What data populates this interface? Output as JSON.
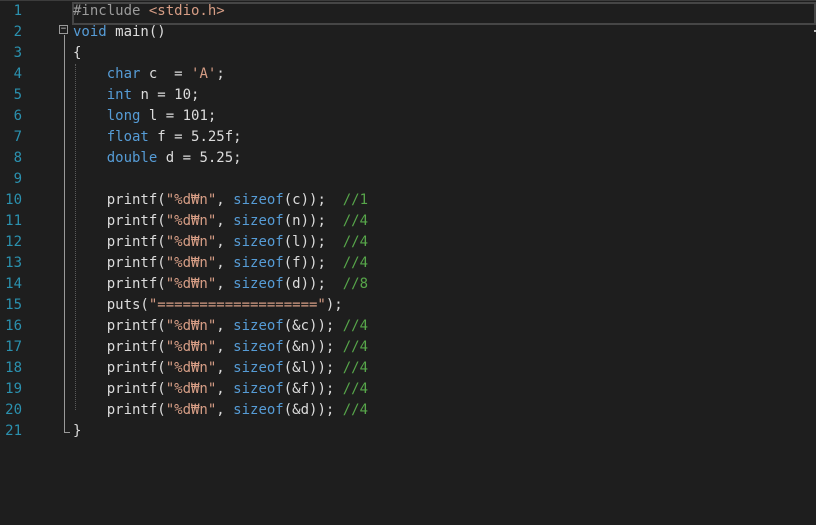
{
  "editor": {
    "line_numbers": [
      "1",
      "2",
      "3",
      "4",
      "5",
      "6",
      "7",
      "8",
      "9",
      "10",
      "11",
      "12",
      "13",
      "14",
      "15",
      "16",
      "17",
      "18",
      "19",
      "20",
      "21"
    ],
    "collapse_symbol": "−",
    "lines": [
      [
        {
          "t": "#include ",
          "c": "pp"
        },
        {
          "t": "<stdio.h>",
          "c": "str"
        }
      ],
      [
        {
          "t": "void",
          "c": "kw"
        },
        {
          "t": " main()",
          "c": "plain"
        }
      ],
      [
        {
          "t": "{",
          "c": "plain"
        }
      ],
      [
        {
          "t": "    ",
          "c": "plain"
        },
        {
          "t": "char",
          "c": "kw"
        },
        {
          "t": " c  = ",
          "c": "plain"
        },
        {
          "t": "'A'",
          "c": "str"
        },
        {
          "t": ";",
          "c": "plain"
        }
      ],
      [
        {
          "t": "    ",
          "c": "plain"
        },
        {
          "t": "int",
          "c": "kw"
        },
        {
          "t": " n = 10;",
          "c": "plain"
        }
      ],
      [
        {
          "t": "    ",
          "c": "plain"
        },
        {
          "t": "long",
          "c": "kw"
        },
        {
          "t": " l = 101;",
          "c": "plain"
        }
      ],
      [
        {
          "t": "    ",
          "c": "plain"
        },
        {
          "t": "float",
          "c": "kw"
        },
        {
          "t": " f = 5.25f;",
          "c": "plain"
        }
      ],
      [
        {
          "t": "    ",
          "c": "plain"
        },
        {
          "t": "double",
          "c": "kw"
        },
        {
          "t": " d = 5.25;",
          "c": "plain"
        }
      ],
      [],
      [
        {
          "t": "    printf(",
          "c": "plain"
        },
        {
          "t": "\"%d₩n\"",
          "c": "str"
        },
        {
          "t": ", ",
          "c": "plain"
        },
        {
          "t": "sizeof",
          "c": "kw"
        },
        {
          "t": "(c));  ",
          "c": "plain"
        },
        {
          "t": "//1",
          "c": "cmt"
        }
      ],
      [
        {
          "t": "    printf(",
          "c": "plain"
        },
        {
          "t": "\"%d₩n\"",
          "c": "str"
        },
        {
          "t": ", ",
          "c": "plain"
        },
        {
          "t": "sizeof",
          "c": "kw"
        },
        {
          "t": "(n));  ",
          "c": "plain"
        },
        {
          "t": "//4",
          "c": "cmt"
        }
      ],
      [
        {
          "t": "    printf(",
          "c": "plain"
        },
        {
          "t": "\"%d₩n\"",
          "c": "str"
        },
        {
          "t": ", ",
          "c": "plain"
        },
        {
          "t": "sizeof",
          "c": "kw"
        },
        {
          "t": "(l));  ",
          "c": "plain"
        },
        {
          "t": "//4",
          "c": "cmt"
        }
      ],
      [
        {
          "t": "    printf(",
          "c": "plain"
        },
        {
          "t": "\"%d₩n\"",
          "c": "str"
        },
        {
          "t": ", ",
          "c": "plain"
        },
        {
          "t": "sizeof",
          "c": "kw"
        },
        {
          "t": "(f));  ",
          "c": "plain"
        },
        {
          "t": "//4",
          "c": "cmt"
        }
      ],
      [
        {
          "t": "    printf(",
          "c": "plain"
        },
        {
          "t": "\"%d₩n\"",
          "c": "str"
        },
        {
          "t": ", ",
          "c": "plain"
        },
        {
          "t": "sizeof",
          "c": "kw"
        },
        {
          "t": "(d));  ",
          "c": "plain"
        },
        {
          "t": "//8",
          "c": "cmt"
        }
      ],
      [
        {
          "t": "    puts(",
          "c": "plain"
        },
        {
          "t": "\"===================\"",
          "c": "str"
        },
        {
          "t": ");",
          "c": "plain"
        }
      ],
      [
        {
          "t": "    printf(",
          "c": "plain"
        },
        {
          "t": "\"%d₩n\"",
          "c": "str"
        },
        {
          "t": ", ",
          "c": "plain"
        },
        {
          "t": "sizeof",
          "c": "kw"
        },
        {
          "t": "(&c)); ",
          "c": "plain"
        },
        {
          "t": "//4",
          "c": "cmt"
        }
      ],
      [
        {
          "t": "    printf(",
          "c": "plain"
        },
        {
          "t": "\"%d₩n\"",
          "c": "str"
        },
        {
          "t": ", ",
          "c": "plain"
        },
        {
          "t": "sizeof",
          "c": "kw"
        },
        {
          "t": "(&n)); ",
          "c": "plain"
        },
        {
          "t": "//4",
          "c": "cmt"
        }
      ],
      [
        {
          "t": "    printf(",
          "c": "plain"
        },
        {
          "t": "\"%d₩n\"",
          "c": "str"
        },
        {
          "t": ", ",
          "c": "plain"
        },
        {
          "t": "sizeof",
          "c": "kw"
        },
        {
          "t": "(&l)); ",
          "c": "plain"
        },
        {
          "t": "//4",
          "c": "cmt"
        }
      ],
      [
        {
          "t": "    printf(",
          "c": "plain"
        },
        {
          "t": "\"%d₩n\"",
          "c": "str"
        },
        {
          "t": ", ",
          "c": "plain"
        },
        {
          "t": "sizeof",
          "c": "kw"
        },
        {
          "t": "(&f)); ",
          "c": "plain"
        },
        {
          "t": "//4",
          "c": "cmt"
        }
      ],
      [
        {
          "t": "    printf(",
          "c": "plain"
        },
        {
          "t": "\"%d₩n\"",
          "c": "str"
        },
        {
          "t": ", ",
          "c": "plain"
        },
        {
          "t": "sizeof",
          "c": "kw"
        },
        {
          "t": "(&d)); ",
          "c": "plain"
        },
        {
          "t": "//4",
          "c": "cmt"
        }
      ],
      [
        {
          "t": "}",
          "c": "plain"
        }
      ]
    ]
  },
  "colors": {
    "background": "#1e1e1e",
    "line_number": "#2b91af",
    "keyword": "#569cd6",
    "string": "#d69d85",
    "comment": "#57a64a",
    "preprocessor": "#9b9b9b",
    "text": "#dcdcdc"
  }
}
